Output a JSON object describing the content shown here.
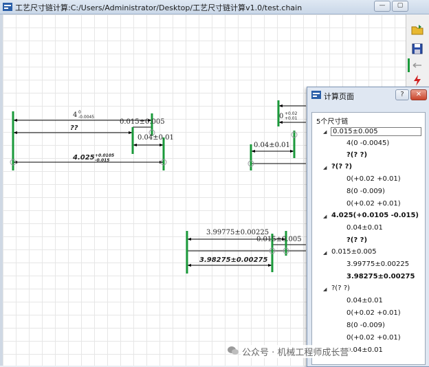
{
  "window": {
    "title": "工艺尺寸链计算:C:/Users/Administrator/Desktop/工艺尺寸链计算v1.0/test.chain",
    "min_glyph": "—",
    "restore_glyph": "▢"
  },
  "drawing": {
    "group1": {
      "top_dim": "4",
      "top_dim_upper": "0",
      "top_dim_lower": "-0.0045",
      "mid_dim": "0.015±0.005",
      "unknown_dim": "??",
      "small_dim": "0.04±0.01",
      "result_dim": "4.025",
      "result_upper": "+0.0105",
      "result_lower": "-0.015"
    },
    "group2": {
      "frag_dim": "0",
      "frag_sup": "+0.02",
      "frag_sup2": "+0.01",
      "small_dim": "0.04±0.01"
    },
    "group3": {
      "top_dim": "3.99775±0.00225",
      "mid_dim": "0.015±0.005",
      "result_dim": "3.98275±0.00275"
    }
  },
  "dialog": {
    "title": "计算页面",
    "help": "?",
    "close": "✕",
    "header": "5个尺寸链",
    "chains": [
      {
        "root": "0.015±0.005",
        "children": [
          "4(0 -0.0045)",
          "?(? ?)"
        ]
      },
      {
        "root": "?(? ?)",
        "children": [
          "0(+0.02 +0.01)",
          "8(0 -0.009)",
          "0(+0.02 +0.01)"
        ]
      },
      {
        "root": "4.025(+0.0105 -0.015)",
        "children": [
          "0.04±0.01",
          "?(? ?)"
        ]
      },
      {
        "root": "0.015±0.005",
        "children": [
          "3.99775±0.00225",
          "3.98275±0.00275"
        ]
      },
      {
        "root": "?(? ?)",
        "children": [
          "0.04±0.01",
          "0(+0.02 +0.01)",
          "8(0 -0.009)",
          "0(+0.02 +0.01)",
          "0.04±0.01"
        ]
      }
    ]
  },
  "watermark": "公众号 · 机械工程师成长营",
  "colors": {
    "green": "#1a9a3a",
    "line": "#000000",
    "circle": "#9a9aa0"
  }
}
